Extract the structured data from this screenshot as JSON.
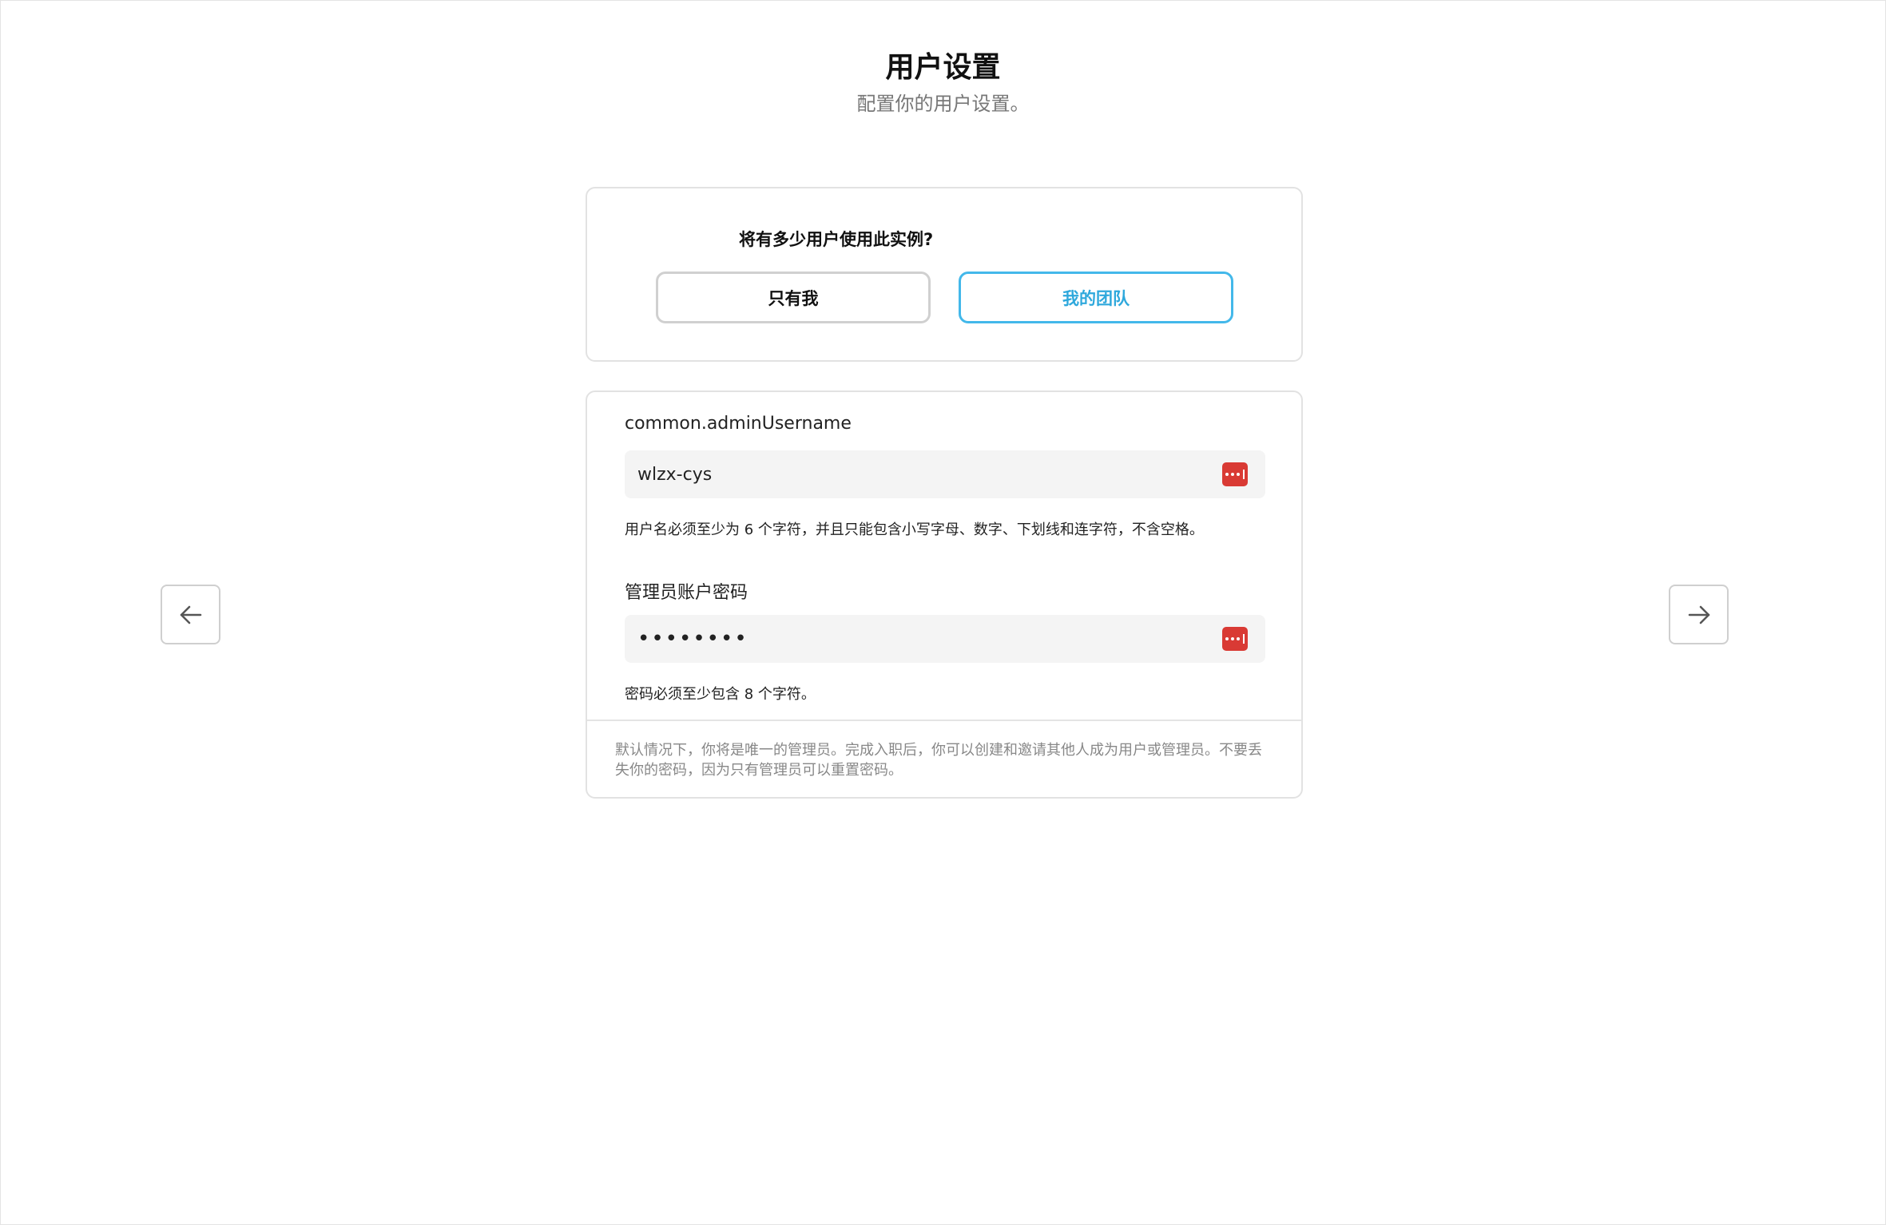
{
  "header": {
    "title": "用户设置",
    "subtitle": "配置你的用户设置。"
  },
  "user_count": {
    "question": "将有多少用户使用此实例?",
    "options": [
      {
        "label": "只有我",
        "selected": false
      },
      {
        "label": "我的团队",
        "selected": true
      }
    ]
  },
  "form": {
    "username": {
      "label": "common.adminUsername",
      "value": "wlzx-cys",
      "hint": "用户名必须至少为 6 个字符，并且只能包含小写字母、数字、下划线和连字符，不含空格。"
    },
    "password": {
      "label": "管理员账户密码",
      "value": "••••••••",
      "hint": "密码必须至少包含 8 个字符。"
    },
    "note": "默认情况下，你将是唯一的管理员。完成入职后，你可以创建和邀请其他人成为用户或管理员。不要丢失你的密码，因为只有管理员可以重置密码。"
  },
  "colors": {
    "accent": "#43b8ea",
    "password_manager_icon": "#d93a34"
  },
  "icons": {
    "prev": "arrow-left-icon",
    "next": "arrow-right-icon",
    "password_manager": "password-manager-icon"
  }
}
